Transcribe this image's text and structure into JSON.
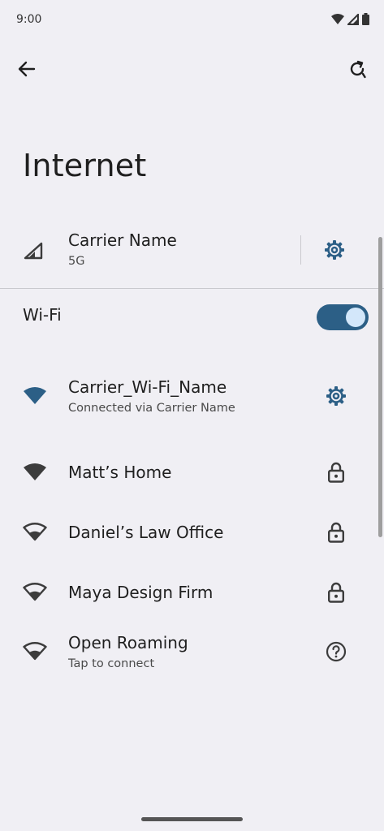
{
  "status_bar": {
    "time": "9:00",
    "icons": [
      "wifi-icon",
      "cell-signal-icon",
      "battery-icon"
    ]
  },
  "toolbar": {
    "back_icon": "arrow-back-icon",
    "refresh_icon": "refresh-icon"
  },
  "page": {
    "title": "Internet"
  },
  "carrier": {
    "name": "Carrier Name",
    "network_type": "5G",
    "icon": "cell-signal-icon",
    "settings_icon": "gear-icon"
  },
  "wifi": {
    "label": "Wi-Fi",
    "enabled": true,
    "networks": [
      {
        "name": "Carrier_Wi-Fi_Name",
        "status": "Connected via Carrier Name",
        "icon": "wifi-connected-icon",
        "right_icon": "gear-icon"
      },
      {
        "name": "Matt’s Home",
        "status": "",
        "icon": "wifi-full-icon",
        "right_icon": "lock-icon"
      },
      {
        "name": "Daniel’s Law Office",
        "status": "",
        "icon": "wifi-partial-icon",
        "right_icon": "lock-icon"
      },
      {
        "name": "Maya Design Firm",
        "status": "",
        "icon": "wifi-partial-icon",
        "right_icon": "lock-icon"
      },
      {
        "name": "Open Roaming",
        "status": "Tap to connect",
        "icon": "wifi-partial-icon",
        "right_icon": "help-icon"
      }
    ]
  },
  "colors": {
    "background": "#F0EFF4",
    "accent": "#2C5F86",
    "toggle_knob": "#D3E7FA",
    "icon_dark": "#3C3C3C"
  }
}
